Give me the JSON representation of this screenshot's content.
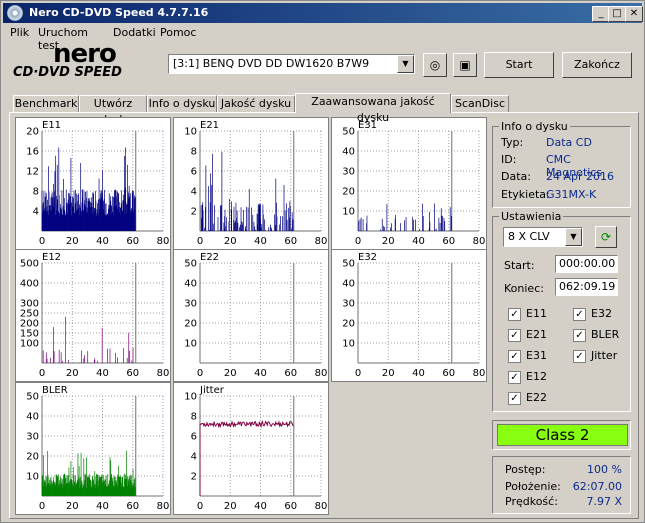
{
  "window": {
    "title": "Nero CD-DVD Speed 4.7.7.16",
    "min": "_",
    "max": "□",
    "close": "✕"
  },
  "menu": [
    "Plik",
    "Uruchom test",
    "Dodatki",
    "Pomoc"
  ],
  "logo": {
    "word": "nero",
    "sub": "CD·DVD SPEED"
  },
  "drive": {
    "selected": "[3:1]  BENQ DVD DD DW1620 B7W9"
  },
  "buttons": {
    "start": "Start",
    "exit": "Zakończ"
  },
  "tabs": [
    "Benchmark",
    "Utwórz dysk",
    "Info o dysku",
    "Jakość dysku",
    "Zaawansowana jakość dysku",
    "ScanDisc"
  ],
  "active_tab": 4,
  "disc_info": {
    "title": "Info o dysku",
    "rows": [
      {
        "label": "Typ:",
        "value": "Data CD"
      },
      {
        "label": "ID:",
        "value": "CMC Magnetics"
      },
      {
        "label": "Data:",
        "value": "24 Apr 2016"
      },
      {
        "label": "Etykieta:",
        "value": "G31MX-K"
      }
    ]
  },
  "settings": {
    "title": "Ustawienia",
    "speed": "8 X CLV",
    "start_label": "Start:",
    "start_value": "000:00.00",
    "end_label": "Koniec:",
    "end_value": "062:09.19",
    "checks": [
      {
        "label": "E11",
        "checked": true
      },
      {
        "label": "E32",
        "checked": true
      },
      {
        "label": "E21",
        "checked": true
      },
      {
        "label": "BLER",
        "checked": true
      },
      {
        "label": "E31",
        "checked": true
      },
      {
        "label": "Jitter",
        "checked": true
      },
      {
        "label": "E12",
        "checked": true
      },
      {
        "label": "E22",
        "checked": true
      }
    ]
  },
  "class_label": "Class 2",
  "status": {
    "progress_label": "Postęp:",
    "progress_value": "100 %",
    "position_label": "Położenie:",
    "position_value": "62:07.00",
    "speed_label": "Prędkość:",
    "speed_value": "7.97 X"
  },
  "colors": {
    "e1": "#000080",
    "e2": "#800080",
    "bler": "#008000",
    "jitter": "#800040",
    "class": "#88ff11"
  },
  "chart_data": [
    {
      "type": "bar",
      "title": "E11",
      "x_ticks": [
        0,
        20,
        40,
        60,
        80
      ],
      "y_ticks": [
        4,
        8,
        12,
        16,
        20
      ],
      "ylim": [
        0,
        20
      ],
      "x_end": 62,
      "color": "#000080",
      "kind": "dense",
      "typical": 6,
      "peak": 17
    },
    {
      "type": "bar",
      "title": "E21",
      "x_ticks": [
        0,
        20,
        40,
        60,
        80
      ],
      "y_ticks": [
        2,
        4,
        6,
        8,
        10
      ],
      "ylim": [
        0,
        10
      ],
      "x_end": 62,
      "color": "#000080",
      "kind": "sparse",
      "typical": 2,
      "peak": 9
    },
    {
      "type": "bar",
      "title": "E31",
      "x_ticks": [
        0,
        20,
        40,
        60,
        80
      ],
      "y_ticks": [
        10,
        20,
        30,
        40,
        50
      ],
      "ylim": [
        0,
        50
      ],
      "x_end": 62,
      "color": "#000080",
      "kind": "rare",
      "typical": 5,
      "peak": 16
    },
    {
      "type": "bar",
      "title": "E12",
      "x_ticks": [
        0,
        20,
        40,
        60,
        80
      ],
      "y_ticks": [
        100,
        150,
        200,
        250,
        300,
        400,
        500
      ],
      "ylim": [
        0,
        500
      ],
      "x_end": 62,
      "color": "#800080",
      "kind": "rare",
      "typical": 40,
      "peak": 290
    },
    {
      "type": "bar",
      "title": "E22",
      "x_ticks": [
        0,
        20,
        40,
        60,
        80
      ],
      "y_ticks": [
        10,
        20,
        30,
        40,
        50
      ],
      "ylim": [
        0,
        50
      ],
      "x_end": 62,
      "color": "#800080",
      "kind": "none"
    },
    {
      "type": "bar",
      "title": "E32",
      "x_ticks": [
        0,
        20,
        40,
        60,
        80
      ],
      "y_ticks": [
        10,
        20,
        30,
        40,
        50
      ],
      "ylim": [
        0,
        50
      ],
      "x_end": 62,
      "color": "#800080",
      "kind": "none"
    },
    {
      "type": "bar",
      "title": "BLER",
      "x_ticks": [
        0,
        20,
        40,
        60,
        80
      ],
      "y_ticks": [
        10,
        20,
        30,
        40,
        50
      ],
      "ylim": [
        0,
        50
      ],
      "x_end": 62,
      "color": "#008000",
      "kind": "dense",
      "typical": 8,
      "peak": 23
    },
    {
      "type": "line",
      "title": "Jitter",
      "x_ticks": [
        0,
        20,
        40,
        60,
        80
      ],
      "y_ticks": [
        2,
        4,
        6,
        8,
        10
      ],
      "ylim": [
        0,
        10
      ],
      "x_end": 62,
      "color": "#800040",
      "kind": "flat",
      "typical": 7.2
    }
  ]
}
